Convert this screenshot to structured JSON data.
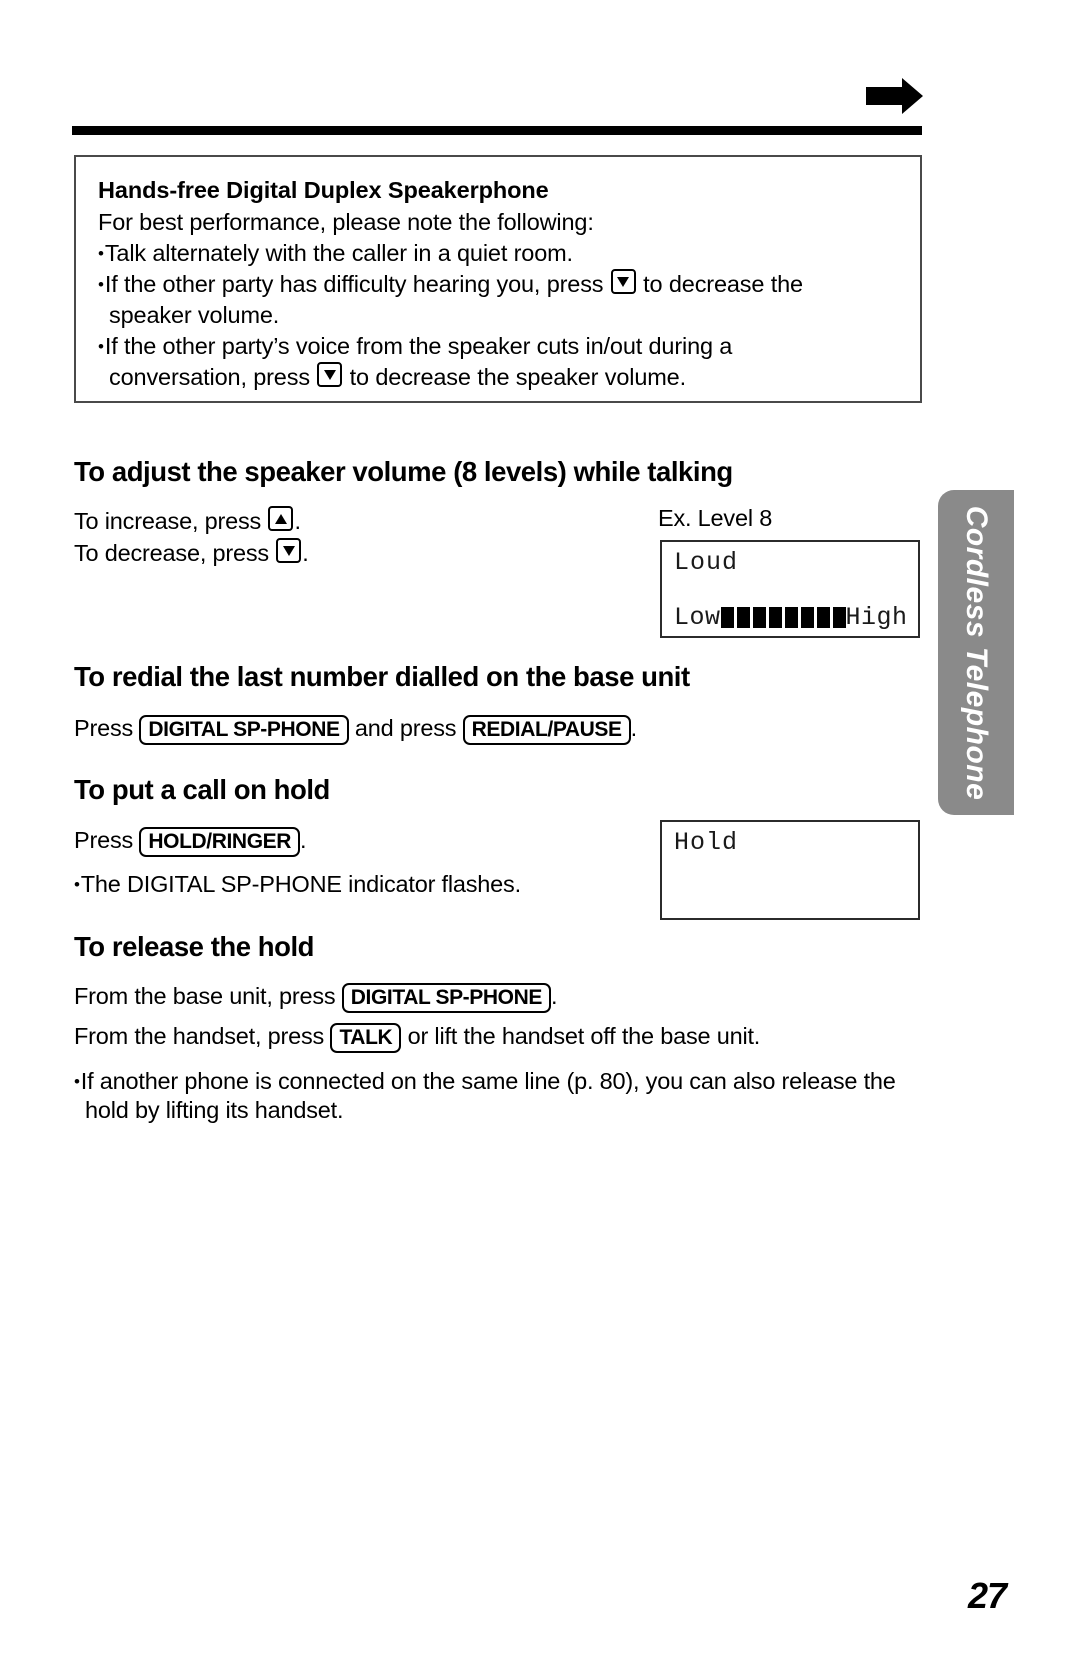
{
  "page": {
    "number": "27",
    "side_tab_label": "Cordless Telephone",
    "top_arrow_icon": "right-arrow-icon"
  },
  "notice": {
    "title": "Hands-free Digital Duplex Speakerphone",
    "intro": "For best performance, please note the following:",
    "bullets": [
      {
        "text_before": "Talk alternately with the caller in a quiet room.",
        "key": null,
        "text_after": "",
        "continuation": ""
      },
      {
        "text_before": "If the other party has difficulty hearing you, press ",
        "key": "down-arrow-key",
        "text_after": " to decrease the",
        "continuation": "speaker volume."
      },
      {
        "text_before": "If the other party’s voice from the speaker cuts in/out during a",
        "key": "down-arrow-key",
        "text_after": "",
        "continuation_before": "conversation, press ",
        "continuation_after": " to decrease the speaker volume."
      }
    ]
  },
  "sections": {
    "volume": {
      "heading": "To adjust the speaker volume (8 levels) while talking",
      "increase_before": "To increase, press ",
      "increase_key": "up-arrow-key",
      "increase_after": ".",
      "decrease_before": "To decrease, press ",
      "decrease_key": "down-arrow-key",
      "decrease_after": ".",
      "example_caption": "Ex. Level 8",
      "lcd": {
        "top_text": "Loud",
        "low_label": "Low",
        "high_label": "High",
        "level": 8,
        "max_level": 8
      }
    },
    "redial": {
      "heading": "To redial the last number dialled on the base unit",
      "press_label": "Press ",
      "button_1": "DIGITAL SP-PHONE",
      "middle_label": " and press ",
      "button_2": "REDIAL/PAUSE",
      "end_label": "."
    },
    "hold": {
      "heading": "To put a call on hold",
      "press_label": "Press ",
      "button_1": "HOLD/RINGER",
      "end_label": ".",
      "bullet": "The DIGITAL SP-PHONE indicator flashes.",
      "lcd": {
        "top_text": "Hold"
      }
    },
    "release": {
      "heading": "To release the hold",
      "line1_before": "From the base unit, press ",
      "line1_button": "DIGITAL SP-PHONE",
      "line1_after": ".",
      "line2_before": "From the handset, press ",
      "line2_button": "TALK",
      "line2_after": " or lift the handset off the base unit.",
      "bullet_line1": "If another phone is connected on the same line (p. 80), you can also release the",
      "bullet_line2": "hold by lifting its handset."
    }
  }
}
